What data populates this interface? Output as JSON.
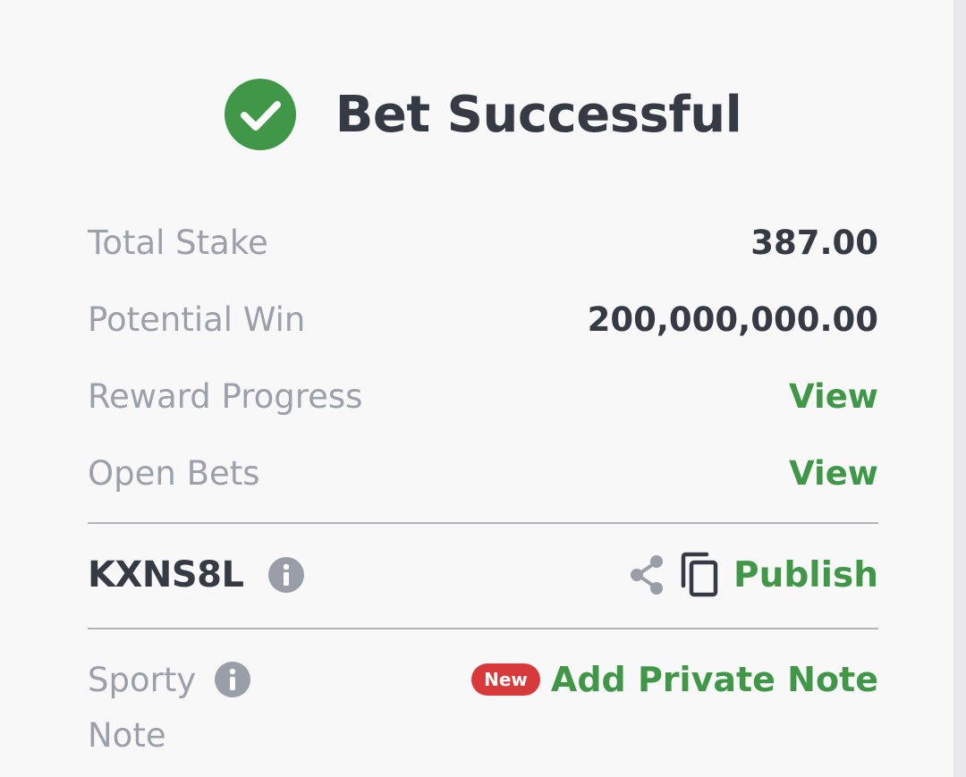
{
  "colors": {
    "success_green": "#3f9747",
    "text_dark": "#353a45",
    "text_muted": "#9ca0ab",
    "badge_red": "#d83a3c",
    "icon_gray": "#9a9ea8"
  },
  "header": {
    "icon": "check-circle-icon",
    "title": "Bet Successful"
  },
  "summary": {
    "total_stake_label": "Total Stake",
    "total_stake_value": "387.00",
    "potential_win_label": "Potential Win",
    "potential_win_value": "200,000,000.00",
    "reward_progress_label": "Reward Progress",
    "reward_progress_link": "View",
    "open_bets_label": "Open Bets",
    "open_bets_link": "View"
  },
  "booking": {
    "code": "KXNS8L",
    "info_icon": "info-icon",
    "share_icon": "share-icon",
    "copy_icon": "copy-icon",
    "publish_label": "Publish"
  },
  "note": {
    "label_line1": "Sporty",
    "label_line2": "Note",
    "info_icon": "info-icon",
    "badge": "New",
    "add_label": "Add Private Note"
  }
}
